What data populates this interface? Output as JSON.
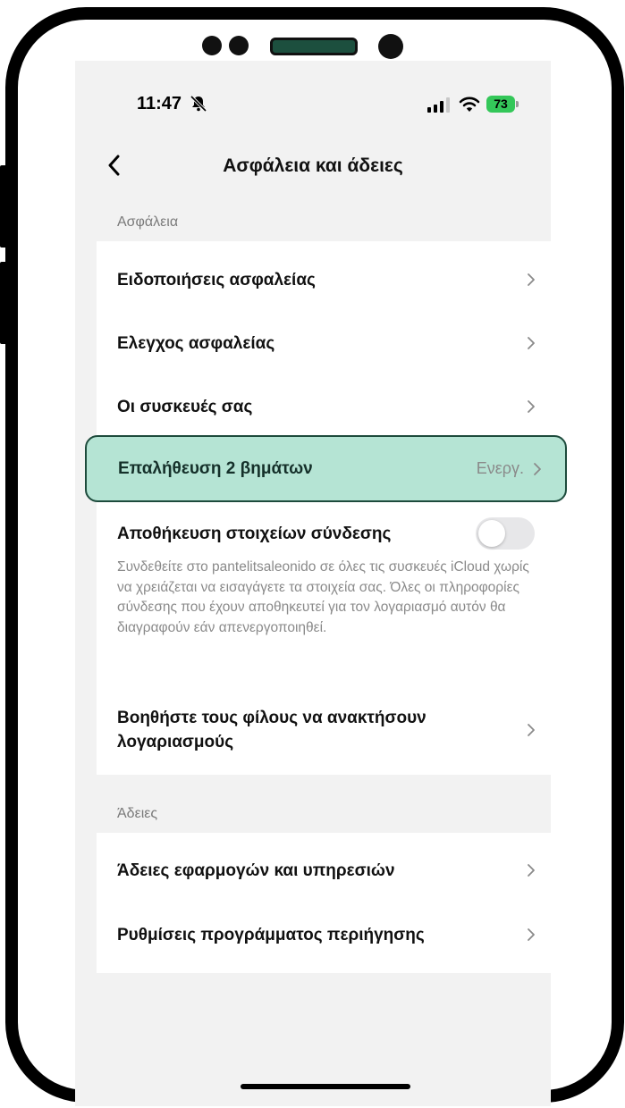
{
  "status_bar": {
    "time": "11:47",
    "battery": "73"
  },
  "nav": {
    "title": "Ασφάλεια και άδειες"
  },
  "security_section": {
    "header": "Ασφάλεια",
    "items": [
      {
        "label": "Ειδοποιήσεις ασφαλείας"
      },
      {
        "label": "Ελεγχος ασφαλείας"
      },
      {
        "label": "Οι συσκευές σας"
      },
      {
        "label": "Επαλήθευση 2 βημάτων",
        "value": "Ενεργ."
      }
    ],
    "save_login": {
      "label": "Αποθήκευση στοιχείων σύνδεσης",
      "enabled": false,
      "description": "Συνδεθείτε στο pantelitsaleonido σε όλες τις συσκευές iCloud χωρίς να χρειάζεται να εισαγάγετε τα στοιχεία σας. Όλες οι πληροφορίες σύνδεσης που έχουν αποθηκευτεί για τον λογαριασμό αυτόν θα διαγραφούν εάν απενεργοποιηθεί."
    },
    "help_friends": {
      "label": "Βοηθήστε τους φίλους να ανακτήσουν λογαριασμούς"
    }
  },
  "permissions_section": {
    "header": "Άδειες",
    "items": [
      {
        "label": "Άδειες εφαρμογών και υπηρεσιών"
      },
      {
        "label": "Ρυθμίσεις προγράμματος περιήγησης"
      }
    ]
  },
  "colors": {
    "highlight": "#b5e4d4",
    "highlight_border": "#1d4b3c",
    "battery": "#34c759"
  }
}
